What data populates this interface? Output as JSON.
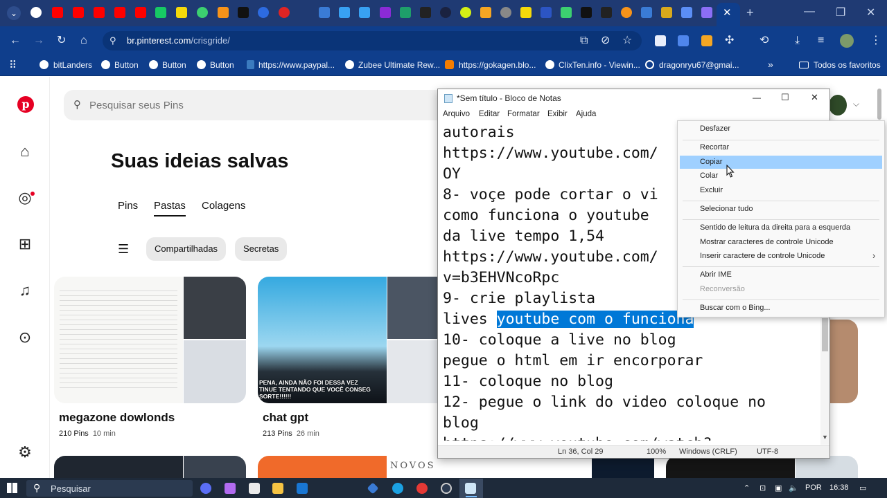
{
  "browser": {
    "url_host": "br.pinterest.com",
    "url_path": "/crisgride/",
    "bookmarks": [
      {
        "label": "bitLanders"
      },
      {
        "label": "Button"
      },
      {
        "label": "Button"
      },
      {
        "label": "Button"
      },
      {
        "label": "https://www.paypal..."
      },
      {
        "label": "Zubee Ultimate Rew..."
      },
      {
        "label": "https://gokagen.blo..."
      },
      {
        "label": "ClixTen.info - Viewin..."
      },
      {
        "label": "dragonryu67@gmai..."
      }
    ],
    "favorites_label": "Todos os favoritos",
    "more_bookmarks": "»"
  },
  "pinterest": {
    "search_placeholder": "Pesquisar seus Pins",
    "heading": "Suas ideias salvas",
    "tabs": [
      "Pins",
      "Pastas",
      "Colagens"
    ],
    "active_tab": "Pastas",
    "chips": [
      "Compartilhadas",
      "Secretas"
    ],
    "boards": [
      {
        "title": "megazone dowlonds",
        "count": "210 Pins",
        "time": "10 min"
      },
      {
        "title": "chat gpt",
        "count": "213 Pins",
        "time": "26 min",
        "overlay": "PENA, AINDA NÃO FOI DESSA VEZ\nTINUE TENTANDO QUE VOCÊ CONSEG\nSORTE!!!!!!"
      }
    ],
    "novos_label": "NOVOS"
  },
  "notepad": {
    "title": "*Sem título - Bloco de Notas",
    "menu": [
      "Arquivo",
      "Editar",
      "Formatar",
      "Exibir",
      "Ajuda"
    ],
    "lines": [
      "autorais",
      "https://www.youtube.com/",
      "OY",
      "8- voçe pode cortar o vi",
      "como funciona o youtube",
      "da live tempo 1,54",
      "https://www.youtube.com/",
      "v=b3EHVNcoRpc",
      "9- crie playlista"
    ],
    "selected_line_prefix": "lives ",
    "selected_text": "youtube com o funciona",
    "lines_after": [
      "10- coloque a live no blog",
      "pegue o html em ir encorporar",
      "11- coloque no blog",
      "12- pegue o link do video coloque no",
      "blog",
      "https://www.youtube.com/watch?"
    ],
    "status": {
      "position": "Ln 36, Col 29",
      "zoom": "100%",
      "eol": "Windows (CRLF)",
      "encoding": "UTF-8"
    }
  },
  "context_menu": {
    "items": [
      {
        "label": "Desfazer",
        "enabled": true
      },
      {
        "label": "Recortar",
        "enabled": true
      },
      {
        "label": "Copiar",
        "enabled": true,
        "highlighted": true
      },
      {
        "label": "Colar",
        "enabled": true
      },
      {
        "label": "Excluir",
        "enabled": true
      },
      {
        "label": "Selecionar tudo",
        "enabled": true
      },
      {
        "label": "Sentido de leitura da direita para a esquerda",
        "enabled": true
      },
      {
        "label": "Mostrar caracteres de controle Unicode",
        "enabled": true
      },
      {
        "label": "Inserir caractere de controle Unicode",
        "enabled": true,
        "submenu": "›"
      },
      {
        "label": "Abrir IME",
        "enabled": true
      },
      {
        "label": "Reconversão",
        "enabled": false
      },
      {
        "label": "Buscar com o Bing...",
        "enabled": true
      }
    ]
  },
  "taskbar": {
    "search_placeholder": "Pesquisar",
    "language": "POR",
    "time": "16:38"
  },
  "colors": {
    "pinterest_red": "#e60023",
    "browser_toolbar": "#0f3e8c",
    "selection": "#0078d7",
    "menu_highlight": "#9fd0ff"
  }
}
